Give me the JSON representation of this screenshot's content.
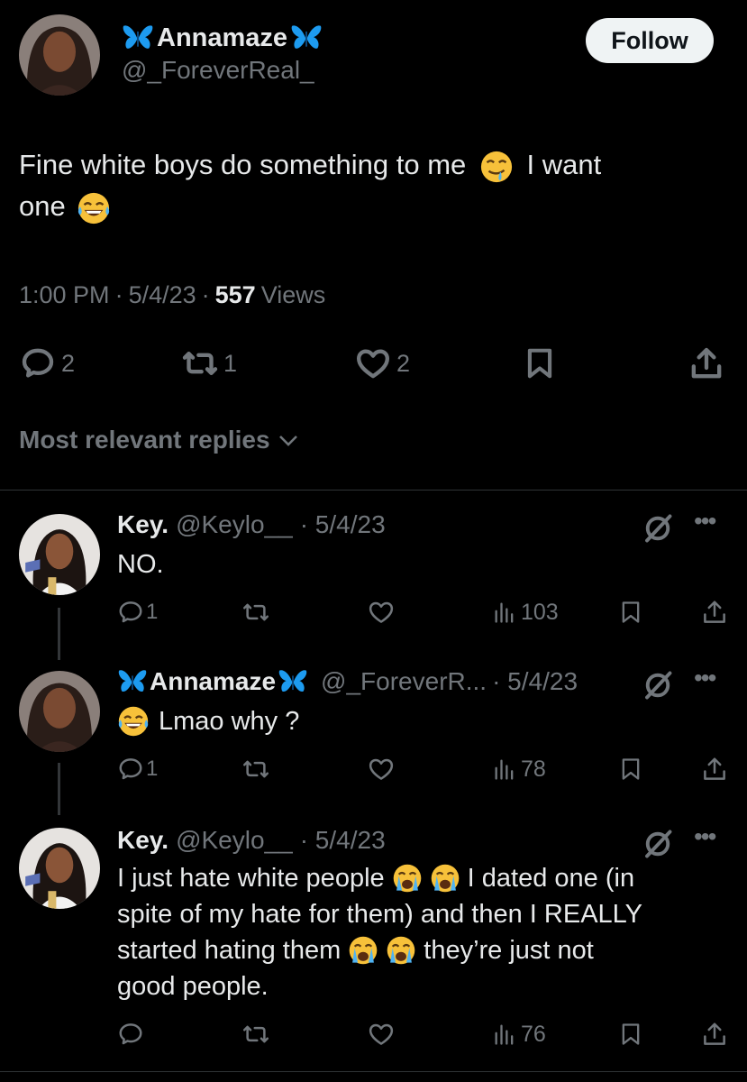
{
  "tweet": {
    "display_name": "Annamaze",
    "handle": "@_ForeverReal_",
    "follow_label": "Follow",
    "text_part1": "Fine white boys do something to me",
    "text_part2": "I want",
    "text_part3": "one",
    "time": "1:00 PM",
    "date": "5/4/23",
    "separator": "·",
    "views_count": "557",
    "views_label": "Views",
    "reply_count": "2",
    "retweet_count": "1",
    "like_count": "2"
  },
  "replies_sort": {
    "label": "Most relevant replies"
  },
  "replies": [
    {
      "display_name": "Key.",
      "handle": "@Keylo__",
      "date": "· 5/4/23",
      "text": "NO.",
      "reply_count": "1",
      "views": "103"
    },
    {
      "display_name": "Annamaze",
      "handle": "@_ForeverR...",
      "date": "· 5/4/23",
      "text": "Lmao why ?",
      "reply_count": "1",
      "views": "78"
    },
    {
      "display_name": "Key.",
      "handle": "@Keylo__",
      "date": "· 5/4/23",
      "text_line1_a": "I just hate white people",
      "text_line1_b": "I dated one (in",
      "text_line2": "spite of my hate for them) and then I REALLY",
      "text_line3_a": "started hating them",
      "text_line3_b": "they’re just not",
      "text_line4": "good people.",
      "views": "76"
    }
  ],
  "colors": {
    "background": "#000000",
    "text": "#e7e9ea",
    "muted": "#71767b",
    "butterfly": "#1d9bf0",
    "follow_bg": "#eff3f4"
  }
}
